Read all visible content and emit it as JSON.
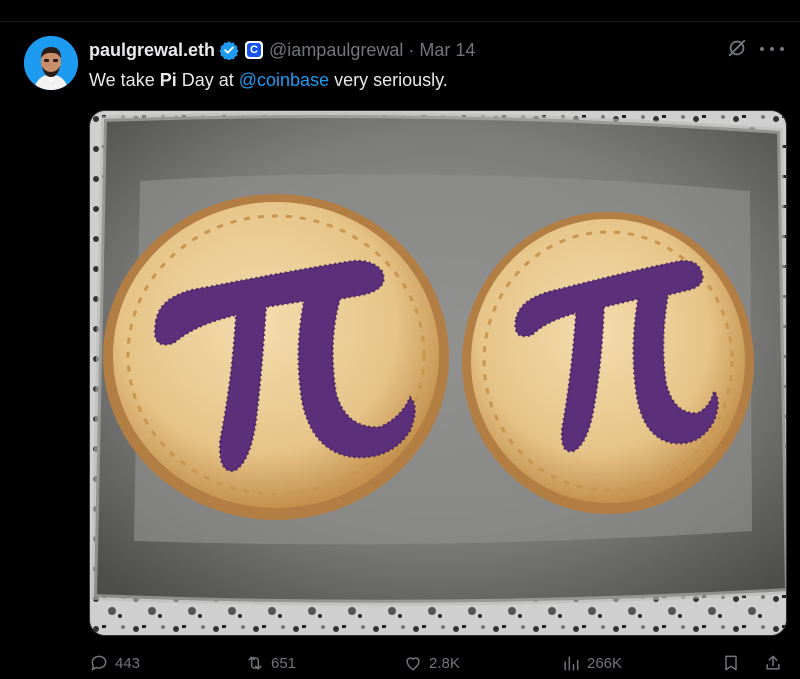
{
  "tweet": {
    "display_name": "paulgrewal.eth",
    "handle": "@iampaulgrewal",
    "separator": "·",
    "date": "Mar 14",
    "affiliation_badge": "C",
    "text_before": "We take ",
    "text_bold": "Pi",
    "text_mid": " Day at ",
    "mention": "@coinbase",
    "text_after": " very seriously."
  },
  "metrics": {
    "replies": "443",
    "retweets": "651",
    "likes": "2.8K",
    "views": "266K"
  },
  "media": {
    "description_icon": "photo",
    "pie_symbol_left": "π",
    "pie_symbol_right": "π"
  },
  "colors": {
    "background": "#000000",
    "text_primary": "#e7e9ea",
    "text_secondary": "#71767b",
    "accent": "#1d9bf0",
    "coinbase_blue": "#1652f0",
    "pie_crust": "#d9a960",
    "pie_filling_sugar": "#5b2f7a"
  }
}
